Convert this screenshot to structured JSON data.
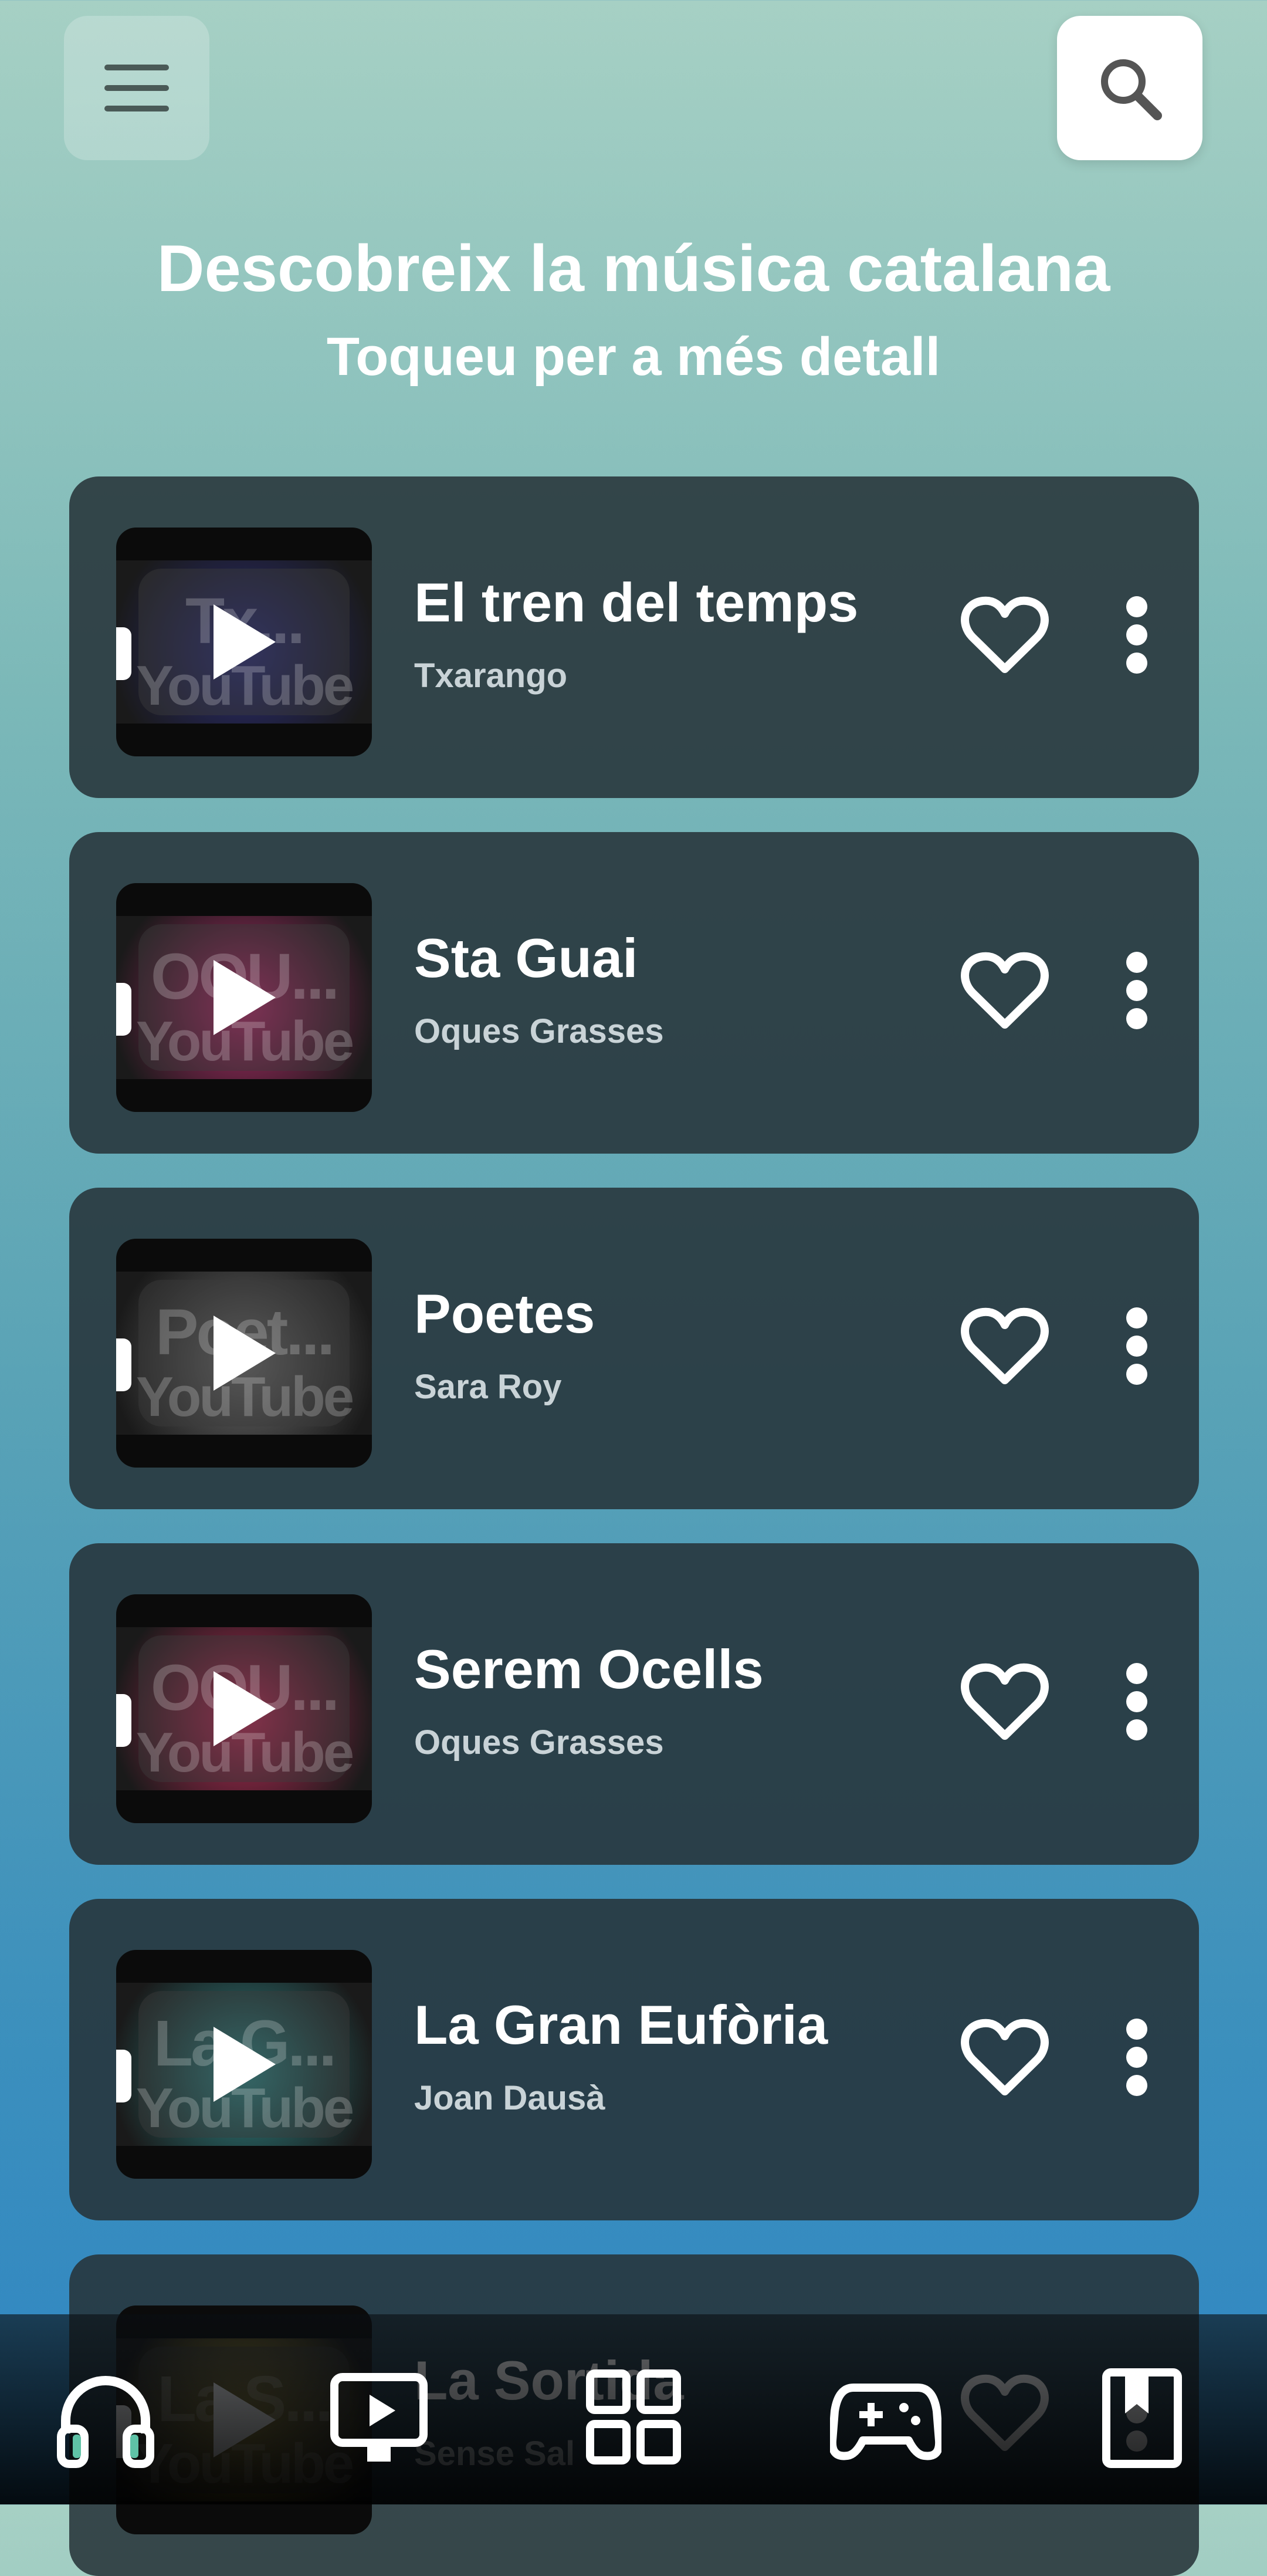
{
  "header": {
    "title": "Descobreix la música catalana",
    "subtitle": "Toqueu per a més detall",
    "menu_icon": "hamburger-menu-icon",
    "search_icon": "search-icon"
  },
  "thumbnail_watermark": "YouTube",
  "songs": [
    {
      "title": "El tren del temps",
      "artist": "Txarango",
      "thumb_text": "Tx...",
      "thumb_color": "#2a2c7a"
    },
    {
      "title": "Sta Guai",
      "artist": "Oques Grasses",
      "thumb_text": "OQU...",
      "thumb_color": "#b52a6a"
    },
    {
      "title": "Poetes",
      "artist": "Sara Roy",
      "thumb_text": "Poet...",
      "thumb_color": "#6f6f6f"
    },
    {
      "title": "Serem Ocells",
      "artist": "Oques Grasses",
      "thumb_text": "OQU...",
      "thumb_color": "#c02a58"
    },
    {
      "title": "La Gran Eufòria",
      "artist": "Joan Dausà",
      "thumb_text": "La G...",
      "thumb_color": "#2e8a8a"
    },
    {
      "title": "La Sortida",
      "artist": "Sense Sal",
      "thumb_text": "La S...",
      "thumb_color": "#d4b93c"
    }
  ],
  "bottom_nav": [
    {
      "name": "music",
      "icon": "headphones-icon"
    },
    {
      "name": "videos",
      "icon": "video-player-icon"
    },
    {
      "name": "categories",
      "icon": "grid-icon"
    },
    {
      "name": "games",
      "icon": "gamepad-icon"
    },
    {
      "name": "saved",
      "icon": "bookmark-icon"
    }
  ],
  "colors": {
    "card_background": "#263238",
    "text_primary": "#ffffff",
    "text_secondary": "#c9d3d7"
  }
}
